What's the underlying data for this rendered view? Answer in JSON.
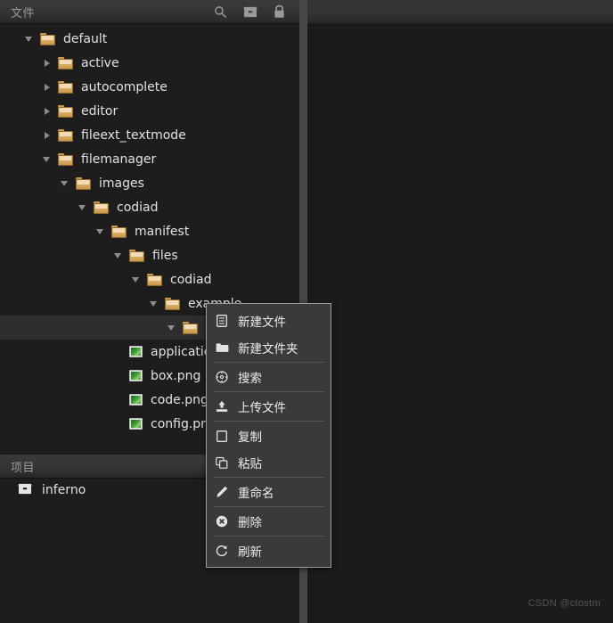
{
  "app": {
    "theme_bg": "#1d1d1d",
    "accent_folder": "#dcb26d",
    "watermark": "CSDN @ctostm"
  },
  "sidebar": {
    "files_panel": {
      "title": "文件",
      "icons": [
        {
          "name": "search-icon",
          "glyph": "search"
        },
        {
          "name": "archive-box-icon",
          "glyph": "box"
        },
        {
          "name": "lock-icon",
          "glyph": "lock"
        }
      ]
    },
    "tree": [
      {
        "label": "default",
        "type": "folder",
        "depth": 0,
        "state": "expanded",
        "highlighted": false
      },
      {
        "label": "active",
        "type": "folder",
        "depth": 1,
        "state": "collapsed",
        "highlighted": false
      },
      {
        "label": "autocomplete",
        "type": "folder",
        "depth": 1,
        "state": "collapsed",
        "highlighted": false
      },
      {
        "label": "editor",
        "type": "folder",
        "depth": 1,
        "state": "collapsed",
        "highlighted": false
      },
      {
        "label": "fileext_textmode",
        "type": "folder",
        "depth": 1,
        "state": "collapsed",
        "highlighted": false
      },
      {
        "label": "filemanager",
        "type": "folder",
        "depth": 1,
        "state": "expanded",
        "highlighted": false
      },
      {
        "label": "images",
        "type": "folder",
        "depth": 2,
        "state": "expanded",
        "highlighted": false
      },
      {
        "label": "codiad",
        "type": "folder",
        "depth": 3,
        "state": "expanded",
        "highlighted": false
      },
      {
        "label": "manifest",
        "type": "folder",
        "depth": 4,
        "state": "expanded",
        "highlighted": false
      },
      {
        "label": "files",
        "type": "folder",
        "depth": 5,
        "state": "expanded",
        "highlighted": false
      },
      {
        "label": "codiad",
        "type": "folder",
        "depth": 6,
        "state": "expanded",
        "highlighted": false
      },
      {
        "label": "example",
        "type": "folder",
        "depth": 7,
        "state": "expanded",
        "highlighted": false
      },
      {
        "label": "",
        "type": "folder",
        "depth": 8,
        "state": "expanded",
        "highlighted": true
      },
      {
        "label": "application.png",
        "type": "file",
        "depth": 5,
        "state": "none",
        "highlighted": false
      },
      {
        "label": "box.png",
        "type": "file",
        "depth": 5,
        "state": "none",
        "highlighted": false
      },
      {
        "label": "code.png",
        "type": "file",
        "depth": 5,
        "state": "none",
        "highlighted": false
      },
      {
        "label": "config.png",
        "type": "file",
        "depth": 5,
        "state": "none",
        "highlighted": false
      }
    ],
    "projects_panel": {
      "title": "项目",
      "items": [
        {
          "label": "inferno",
          "icon": "briefcase-icon"
        }
      ]
    }
  },
  "context_menu": {
    "groups": [
      [
        {
          "label": "新建文件",
          "icon": "new-file-icon"
        },
        {
          "label": "新建文件夹",
          "icon": "new-folder-icon"
        }
      ],
      [
        {
          "label": "搜索",
          "icon": "search-icon"
        }
      ],
      [
        {
          "label": "上传文件",
          "icon": "upload-icon"
        }
      ],
      [
        {
          "label": "复制",
          "icon": "copy-icon"
        },
        {
          "label": "粘贴",
          "icon": "paste-icon"
        }
      ],
      [
        {
          "label": "重命名",
          "icon": "pencil-icon"
        }
      ],
      [
        {
          "label": "删除",
          "icon": "delete-icon"
        }
      ],
      [
        {
          "label": "刷新",
          "icon": "refresh-icon"
        }
      ]
    ]
  }
}
